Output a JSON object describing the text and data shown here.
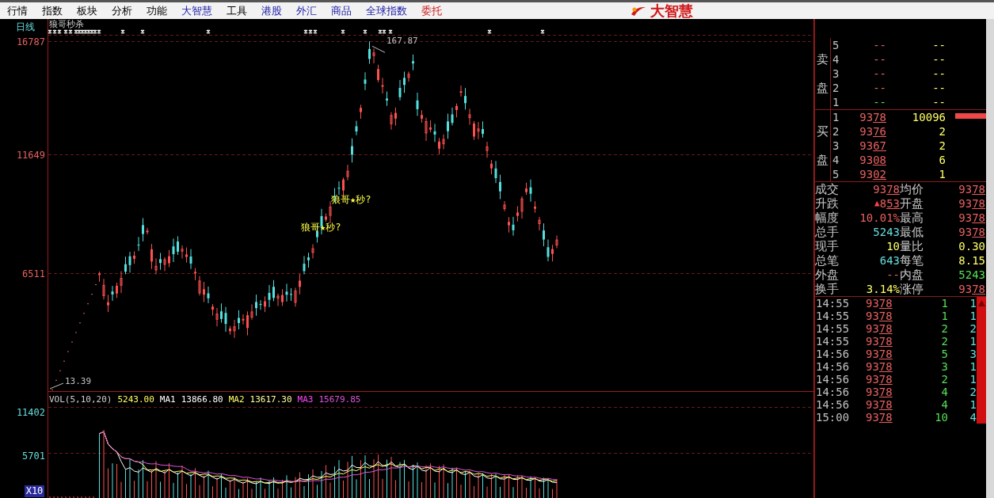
{
  "menu": [
    {
      "label": "行情",
      "kind": "basic"
    },
    {
      "label": "指数",
      "kind": "basic"
    },
    {
      "label": "板块",
      "kind": "basic"
    },
    {
      "label": "分析",
      "kind": "basic"
    },
    {
      "label": "功能",
      "kind": "basic"
    },
    {
      "label": "大智慧",
      "kind": "market"
    },
    {
      "label": "工具",
      "kind": "basic"
    },
    {
      "label": "港股",
      "kind": "market"
    },
    {
      "label": "外汇",
      "kind": "market"
    },
    {
      "label": "商品",
      "kind": "market"
    },
    {
      "label": "全球指数",
      "kind": "market"
    },
    {
      "label": "委托",
      "kind": "trade"
    }
  ],
  "logo": {
    "text": "大智慧"
  },
  "chart": {
    "period": "日线",
    "indicator": "狼哥秒杀",
    "y_labels": [
      "16787",
      "11649",
      "6511"
    ],
    "high_label": "167.87",
    "low_label": "13.39",
    "signals": [
      "狼哥★秒?",
      "狼哥★秒?"
    ]
  },
  "volume": {
    "legend": [
      {
        "text": "VOL(5,10,20)",
        "color": "#d0d0d0"
      },
      {
        "text": "5243.00",
        "color": "#ffff66"
      },
      {
        "text": "MA1",
        "color": "#ffffff"
      },
      {
        "text": "13866.80",
        "color": "#ffffff"
      },
      {
        "text": "MA2",
        "color": "#ffff66"
      },
      {
        "text": "13617.30",
        "color": "#ffff99"
      },
      {
        "text": "MA3",
        "color": "#ff44ff"
      },
      {
        "text": "15679.85",
        "color": "#dd55dd"
      }
    ],
    "y_labels": [
      "11402",
      "5701"
    ],
    "scale": "X10"
  },
  "order_book": {
    "sell_label": "卖盘",
    "sell": [
      {
        "rank": "5",
        "price": "--",
        "volume": "--",
        "color": "#e86060"
      },
      {
        "rank": "4",
        "price": "--",
        "volume": "--",
        "color": "#e86060"
      },
      {
        "rank": "3",
        "price": "--",
        "volume": "--",
        "color": "#e86060"
      },
      {
        "rank": "2",
        "price": "--",
        "volume": "--",
        "color": "#e86060"
      },
      {
        "rank": "1",
        "price": "--",
        "volume": "--",
        "color": "#55dd55"
      }
    ],
    "buy_label": "买盘",
    "buy": [
      {
        "rank": "1",
        "price": "9378",
        "volume": "10096",
        "level": 1
      },
      {
        "rank": "2",
        "price": "9376",
        "volume": "2"
      },
      {
        "rank": "3",
        "price": "9367",
        "volume": "2"
      },
      {
        "rank": "4",
        "price": "9308",
        "volume": "6"
      },
      {
        "rank": "5",
        "price": "9302",
        "volume": "1"
      }
    ]
  },
  "quote": [
    {
      "left": {
        "label": "成交",
        "value": "9378",
        "color": "#e86060",
        "underlined": true
      },
      "right": {
        "label": "均价",
        "value": "9378",
        "color": "#e86060",
        "underlined": true
      }
    },
    {
      "left": {
        "label": "升跌",
        "value": "853",
        "color": "#e86060",
        "underlined": true,
        "arrow": "▲"
      },
      "right": {
        "label": "开盘",
        "value": "9378",
        "color": "#e86060",
        "underlined": true
      }
    },
    {
      "left": {
        "label": "幅度",
        "value": "10.01%",
        "color": "#e86060",
        "underlined": false
      },
      "right": {
        "label": "最高",
        "value": "9378",
        "color": "#e86060",
        "underlined": true
      }
    },
    {
      "left": {
        "label": "总手",
        "value": "5243",
        "color": "#66dddd",
        "underlined": false
      },
      "right": {
        "label": "最低",
        "value": "9378",
        "color": "#e86060",
        "underlined": true
      }
    },
    {
      "left": {
        "label": "现手",
        "value": "10",
        "color": "#ffff66",
        "underlined": false
      },
      "right": {
        "label": "量比",
        "value": "0.30",
        "color": "#ffff66",
        "underlined": false
      }
    },
    {
      "left": {
        "label": "总笔",
        "value": "643",
        "color": "#66dddd",
        "underlined": false
      },
      "right": {
        "label": "每笔",
        "value": "8.15",
        "color": "#ffff66",
        "underlined": false
      }
    },
    {
      "left": {
        "label": "外盘",
        "value": "--",
        "color": "#e86060",
        "underlined": false
      },
      "right": {
        "label": "内盘",
        "value": "5243",
        "color": "#55dd55",
        "underlined": false
      }
    },
    {
      "left": {
        "label": "换手",
        "value": "3.14%",
        "color": "#ffff66",
        "underlined": false
      },
      "right": {
        "label": "涨停",
        "value": "9378",
        "color": "#e86060",
        "underlined": true
      }
    }
  ],
  "trades": [
    {
      "time": "14:55",
      "price": "9378",
      "volume": "1",
      "count": "1"
    },
    {
      "time": "14:55",
      "price": "9378",
      "volume": "1",
      "count": "1"
    },
    {
      "time": "14:55",
      "price": "9378",
      "volume": "2",
      "count": "2"
    },
    {
      "time": "14:55",
      "price": "9378",
      "volume": "2",
      "count": "1"
    },
    {
      "time": "14:56",
      "price": "9378",
      "volume": "5",
      "count": "3"
    },
    {
      "time": "14:56",
      "price": "9378",
      "volume": "3",
      "count": "1"
    },
    {
      "time": "14:56",
      "price": "9378",
      "volume": "2",
      "count": "1"
    },
    {
      "time": "14:56",
      "price": "9378",
      "volume": "4",
      "count": "2"
    },
    {
      "time": "14:56",
      "price": "9378",
      "volume": "4",
      "count": "1"
    },
    {
      "time": "15:00",
      "price": "9378",
      "volume": "10",
      "count": "4"
    }
  ]
}
